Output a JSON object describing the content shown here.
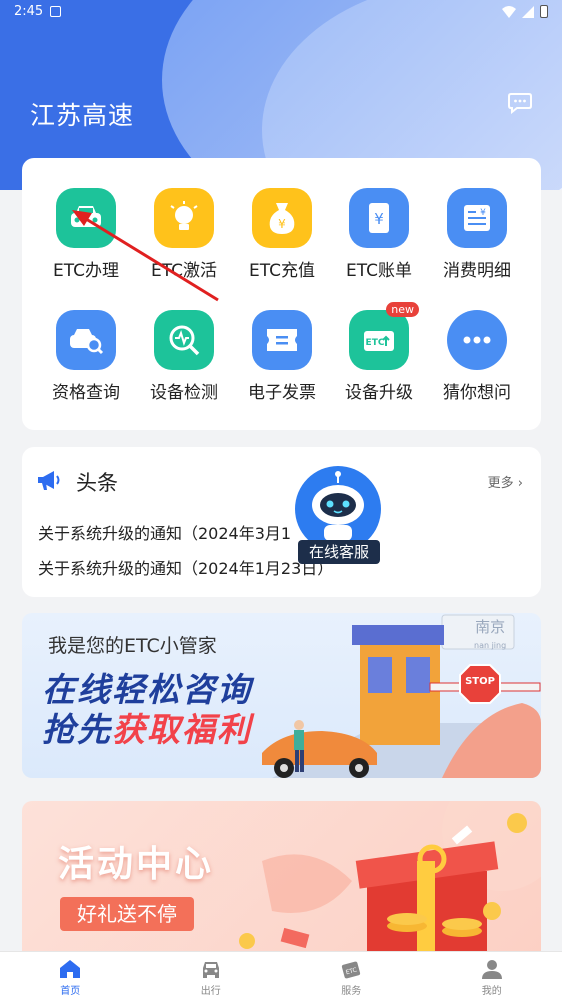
{
  "status_bar": {
    "time": "2:45"
  },
  "header": {
    "title": "江苏高速"
  },
  "colors": {
    "brand": "#3a6fe6",
    "accent_red": "#e8413a",
    "tab_active": "#2d6cf0"
  },
  "services": [
    {
      "label": "ETC办理",
      "icon": "car-icon",
      "color": "#1dc39a"
    },
    {
      "label": "ETC激活",
      "icon": "lightbulb-icon",
      "color": "#ffc21b"
    },
    {
      "label": "ETC充值",
      "icon": "money-bag-icon",
      "color": "#ffc21b"
    },
    {
      "label": "ETC账单",
      "icon": "bill-icon",
      "color": "#4a8ef3"
    },
    {
      "label": "消费明细",
      "icon": "receipt-icon",
      "color": "#4a8ef3"
    },
    {
      "label": "资格查询",
      "icon": "car-search-icon",
      "color": "#4a8ef3"
    },
    {
      "label": "设备检测",
      "icon": "device-check-icon",
      "color": "#1dc39a"
    },
    {
      "label": "电子发票",
      "icon": "ticket-icon",
      "color": "#4a8ef3"
    },
    {
      "label": "设备升级",
      "icon": "etc-card-icon",
      "color": "#1dc39a",
      "badge": "new"
    },
    {
      "label": "猜你想问",
      "icon": "chat-icon",
      "color": "#4a8ef3"
    }
  ],
  "news": {
    "title": "头条",
    "more": "更多",
    "items": [
      "关于系统升级的通知（2024年3月1",
      "关于系统升级的通知（2024年1月23日）"
    ]
  },
  "customer_service": {
    "label": "在线客服"
  },
  "banner_consult": {
    "subtitle": "我是您的ETC小管家",
    "line1": "在线轻松咨询",
    "line2_a": "抢先",
    "line2_b": "获取福利",
    "sign_top": "南京",
    "sign_bottom": "nan jing",
    "stop": "STOP"
  },
  "banner_activity": {
    "title": "活动中心",
    "button": "好礼送不停"
  },
  "tabbar": [
    {
      "label": "首页",
      "icon": "home-icon",
      "active": true
    },
    {
      "label": "出行",
      "icon": "car-icon",
      "active": false
    },
    {
      "label": "服务",
      "icon": "etc-tag-icon",
      "active": false
    },
    {
      "label": "我的",
      "icon": "user-icon",
      "active": false
    }
  ]
}
